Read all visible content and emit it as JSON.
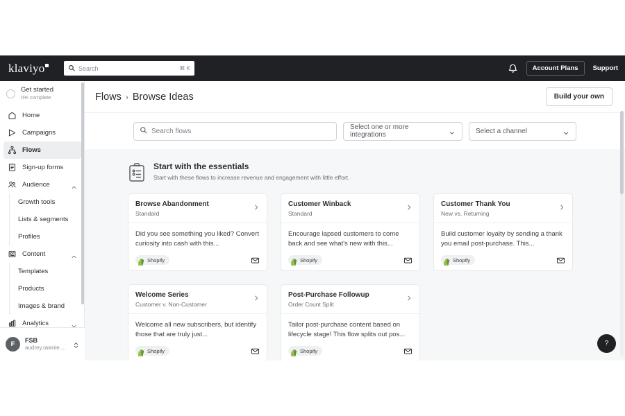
{
  "topnav": {
    "brand": "klaviyo",
    "search_placeholder": "Search",
    "search_shortcut": "⌘ K",
    "notifications_icon": "bell-icon",
    "account_plans_label": "Account Plans",
    "support_label": "Support"
  },
  "sidebar": {
    "get_started": {
      "title": "Get started",
      "subtitle": "0% complete"
    },
    "items": [
      {
        "label": "Home",
        "icon": "home-icon",
        "active": false,
        "expandable": false
      },
      {
        "label": "Campaigns",
        "icon": "send-icon",
        "active": false,
        "expandable": false
      },
      {
        "label": "Flows",
        "icon": "flows-icon",
        "active": true,
        "expandable": false
      },
      {
        "label": "Sign-up forms",
        "icon": "form-icon",
        "active": false,
        "expandable": false
      },
      {
        "label": "Audience",
        "icon": "people-icon",
        "active": false,
        "expandable": true,
        "expanded": true,
        "children": [
          "Growth tools",
          "Lists & segments",
          "Profiles"
        ]
      },
      {
        "label": "Content",
        "icon": "content-icon",
        "active": false,
        "expandable": true,
        "expanded": true,
        "children": [
          "Templates",
          "Products",
          "Images & brand"
        ]
      },
      {
        "label": "Analytics",
        "icon": "analytics-icon",
        "active": false,
        "expandable": true,
        "expanded": false
      }
    ],
    "account": {
      "avatar_initial": "F",
      "name": "FSB",
      "email": "audrey.rawnie...."
    }
  },
  "page": {
    "breadcrumb": {
      "parent": "Flows",
      "separator": "›",
      "current": "Browse Ideas"
    },
    "build_button": "Build your own"
  },
  "filters": {
    "search_placeholder": "Search flows",
    "integrations_value": "Select one or more integrations",
    "channel_value": "Select a channel"
  },
  "section": {
    "title": "Start with the essentials",
    "subtitle": "Start with these flows to increase revenue and engagement with little effort.",
    "icon": "clipboard-icon"
  },
  "cards": [
    {
      "title": "Browse Abandonment",
      "subtitle": "Standard",
      "description": "Did you see something you liked? Convert curiosity into cash with this...",
      "badge": "Shopify",
      "channel_icon": "email-icon"
    },
    {
      "title": "Customer Winback",
      "subtitle": "Standard",
      "description": "Encourage lapsed customers to come back and see what's new with this...",
      "badge": "Shopify",
      "channel_icon": "email-icon"
    },
    {
      "title": "Customer Thank You",
      "subtitle": "New vs. Returning",
      "description": "Build customer loyalty by sending a thank you email post-purchase. This...",
      "badge": "Shopify",
      "channel_icon": "email-icon"
    },
    {
      "title": "Welcome Series",
      "subtitle": "Customer v. Non-Customer",
      "description": "Welcome all new subscribers, but identify those that are truly just...",
      "badge": "Shopify",
      "channel_icon": "email-icon"
    },
    {
      "title": "Post-Purchase Followup",
      "subtitle": "Order Count Split",
      "description": "Tailor post-purchase content based on lifecycle stage! This flow splits out pos...",
      "badge": "Shopify",
      "channel_icon": "email-icon"
    }
  ],
  "help": {
    "label": "?"
  },
  "colors": {
    "topnav_bg": "#1f2124",
    "active_nav_bg": "#eceef0",
    "content_bg": "#f6f7f8",
    "border": "#e6e8ea",
    "shopify_green": "#95bf47"
  }
}
